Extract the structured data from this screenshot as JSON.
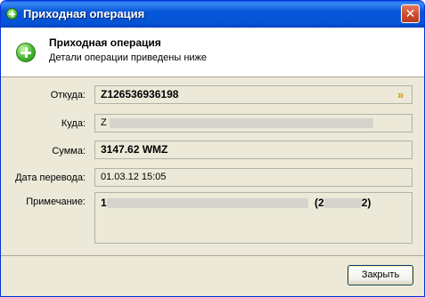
{
  "window": {
    "title": "Приходная операция",
    "close_label": "✕"
  },
  "header": {
    "title": "Приходная операция",
    "subtitle": "Детали операции приведены ниже"
  },
  "fields": {
    "from_label": "Откуда:",
    "from_value": "Z126536936198",
    "to_label": "Куда:",
    "to_value": "Z",
    "amount_label": "Сумма:",
    "amount_value": "3147.62 WMZ",
    "date_label": "Дата перевода:",
    "date_value": "01.03.12 15:05",
    "note_label": "Примечание:",
    "note_value_start": "1",
    "note_value_paren": "(2",
    "note_value_end": "2)"
  },
  "footer": {
    "close_button_label": "Закрыть"
  },
  "colors": {
    "titlebar": "#0757d8",
    "dialog_background": "#ece9d8",
    "header_icon": "#45b52e",
    "arrow_icon": "#d49a00"
  }
}
